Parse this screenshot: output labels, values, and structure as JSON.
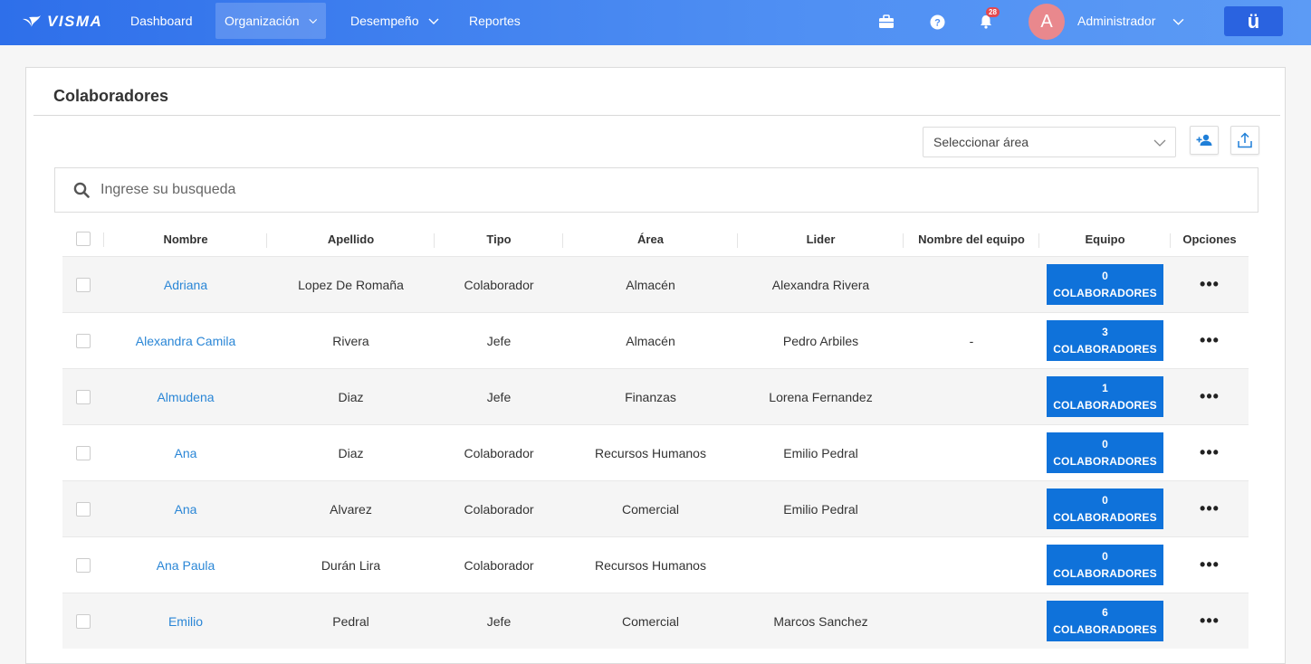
{
  "nav": {
    "brand": "VISMA",
    "items": [
      {
        "label": "Dashboard"
      },
      {
        "label": "Organización"
      },
      {
        "label": "Desempeño"
      },
      {
        "label": "Reportes"
      }
    ],
    "notifications_count": "28",
    "user_initial": "A",
    "user_name": "Administrador",
    "app_badge": "ü"
  },
  "page": {
    "title": "Colaboradores",
    "area_select": "Seleccionar área",
    "search_placeholder": "Ingrese su busqueda"
  },
  "table": {
    "headers": [
      "Nombre",
      "Apellido",
      "Tipo",
      "Área",
      "Lider",
      "Nombre del equipo",
      "Equipo",
      "Opciones"
    ],
    "rows": [
      {
        "nombre": "Adriana",
        "apellido": "Lopez De Romaña",
        "tipo": "Colaborador",
        "area": "Almacén",
        "lider": "Alexandra Rivera",
        "equipo_nombre": "",
        "equipo_count": "0",
        "equipo_label": "COLABORADORES"
      },
      {
        "nombre": "Alexandra Camila",
        "apellido": "Rivera",
        "tipo": "Jefe",
        "area": "Almacén",
        "lider": "Pedro Arbiles",
        "equipo_nombre": "-",
        "equipo_count": "3",
        "equipo_label": "COLABORADORES"
      },
      {
        "nombre": "Almudena",
        "apellido": "Diaz",
        "tipo": "Jefe",
        "area": "Finanzas",
        "lider": "Lorena Fernandez",
        "equipo_nombre": "",
        "equipo_count": "1",
        "equipo_label": "COLABORADORES"
      },
      {
        "nombre": "Ana",
        "apellido": "Diaz",
        "tipo": "Colaborador",
        "area": "Recursos Humanos",
        "lider": "Emilio Pedral",
        "equipo_nombre": "",
        "equipo_count": "0",
        "equipo_label": "COLABORADORES"
      },
      {
        "nombre": "Ana",
        "apellido": "Alvarez",
        "tipo": "Colaborador",
        "area": "Comercial",
        "lider": "Emilio Pedral",
        "equipo_nombre": "",
        "equipo_count": "0",
        "equipo_label": "COLABORADORES"
      },
      {
        "nombre": "Ana Paula",
        "apellido": "Durán Lira",
        "tipo": "Colaborador",
        "area": "Recursos Humanos",
        "lider": "",
        "equipo_nombre": "",
        "equipo_count": "0",
        "equipo_label": "COLABORADORES"
      },
      {
        "nombre": "Emilio",
        "apellido": "Pedral",
        "tipo": "Jefe",
        "area": "Comercial",
        "lider": "Marcos Sanchez",
        "equipo_nombre": "",
        "equipo_count": "6",
        "equipo_label": "COLABORADORES"
      }
    ],
    "options_glyph": "•••"
  },
  "colors": {
    "nav_gradient_start": "#2e6fea",
    "nav_gradient_end": "#5c9bf5",
    "link": "#2a86d6",
    "team_button": "#0f72da",
    "avatar": "#e9888d"
  }
}
